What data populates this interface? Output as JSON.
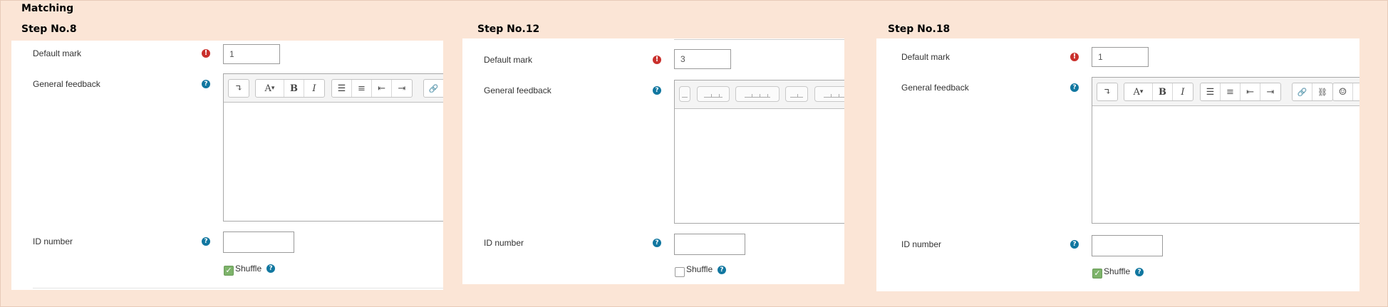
{
  "title": "Matching",
  "steps": [
    {
      "title": "Step No.8",
      "default_mark_label": "Default mark",
      "default_mark_value": "1",
      "general_feedback_label": "General feedback",
      "id_number_label": "ID number",
      "id_number_value": "",
      "shuffle_label": "Shuffle",
      "shuffle_checked": true
    },
    {
      "title": "Step No.12",
      "default_mark_label": "Default mark",
      "default_mark_value": "3",
      "general_feedback_label": "General feedback",
      "id_number_label": "ID number",
      "id_number_value": "",
      "shuffle_label": "Shuffle",
      "shuffle_checked": false
    },
    {
      "title": "Step No.18",
      "default_mark_label": "Default mark",
      "default_mark_value": "1",
      "general_feedback_label": "General feedback",
      "id_number_label": "ID number",
      "id_number_value": "",
      "shuffle_label": "Shuffle",
      "shuffle_checked": true
    }
  ],
  "icons": {
    "required": "!",
    "help": "?",
    "check": "✓",
    "paragraph": "↴",
    "font": "A",
    "caret": "▾",
    "bold": "B",
    "italic": "I",
    "unordered_list": "☰",
    "ordered_list": "≡",
    "outdent": "⇤",
    "indent": "⇥",
    "link": "🔗",
    "unlink": "⛓",
    "emoticon": "☺"
  },
  "colors": {
    "background": "#fbe5d6",
    "panel": "#ffffff",
    "required": "#c9302c",
    "help": "#1177a0",
    "check": "#7db36a"
  }
}
